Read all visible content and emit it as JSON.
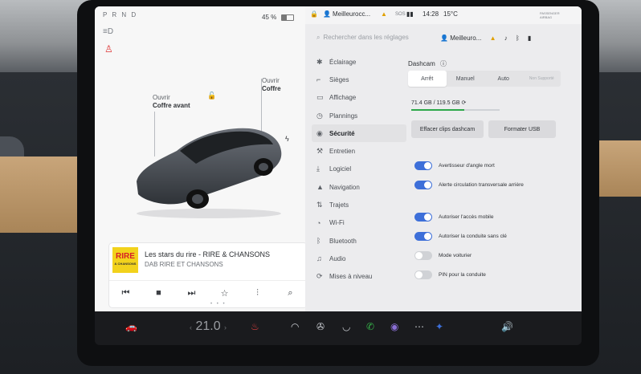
{
  "status": {
    "gear": "P R N D",
    "battery_percent": "45 %",
    "battery_level": 0.45,
    "profile_name": "Meilleurocc...",
    "sos": "SOS",
    "time": "14:28",
    "temperature": "15°C",
    "airbag": "PASSENGER AIRBAG"
  },
  "car_view": {
    "front_trunk": {
      "action": "Ouvrir",
      "name": "Coffre avant"
    },
    "rear_trunk": {
      "action": "Ouvrir",
      "name": "Coffre"
    }
  },
  "media": {
    "art_text": "RIRE",
    "art_subtext": "& CHANSONS",
    "title": "Les stars du rire - RIRE & CHANSONS",
    "subtitle": "DAB RIRE ET CHANSONS"
  },
  "settings": {
    "search_placeholder": "Rechercher dans les réglages",
    "profile": "Meilleuro...",
    "nav": [
      {
        "icon": "light-icon",
        "label": "Éclairage"
      },
      {
        "icon": "seat-icon",
        "label": "Sièges"
      },
      {
        "icon": "display-icon",
        "label": "Affichage"
      },
      {
        "icon": "schedule-icon",
        "label": "Plannings"
      },
      {
        "icon": "security-icon",
        "label": "Sécurité",
        "active": true
      },
      {
        "icon": "wrench-icon",
        "label": "Entretien"
      },
      {
        "icon": "download-icon",
        "label": "Logiciel"
      },
      {
        "icon": "navigation-icon",
        "label": "Navigation"
      },
      {
        "icon": "trips-icon",
        "label": "Trajets"
      },
      {
        "icon": "wifi-icon",
        "label": "Wi-Fi"
      },
      {
        "icon": "bluetooth-icon",
        "label": "Bluetooth"
      },
      {
        "icon": "audio-icon",
        "label": "Audio"
      },
      {
        "icon": "update-icon",
        "label": "Mises à niveau"
      }
    ],
    "dashcam": {
      "title": "Dashcam",
      "options": [
        "Arrêt",
        "Manuel",
        "Auto",
        "Non Supporté"
      ],
      "selected": "Arrêt",
      "storage": "71.4 GB / 119.5 GB",
      "storage_fraction": 0.6,
      "clear_button": "Effacer clips dashcam",
      "format_button": "Formater USB"
    },
    "toggles": [
      {
        "label": "Avertisseur d'angle mort",
        "on": true
      },
      {
        "label": "Alerte circulation transversale arrière",
        "on": true
      },
      {
        "label": "Autoriser l'accès mobile",
        "on": true
      },
      {
        "label": "Autoriser la conduite sans clé",
        "on": true
      },
      {
        "label": "Mode voiturier",
        "on": false
      },
      {
        "label": "PIN pour la conduite",
        "on": false
      }
    ]
  },
  "taskbar": {
    "cabin_temp": "21.0"
  }
}
